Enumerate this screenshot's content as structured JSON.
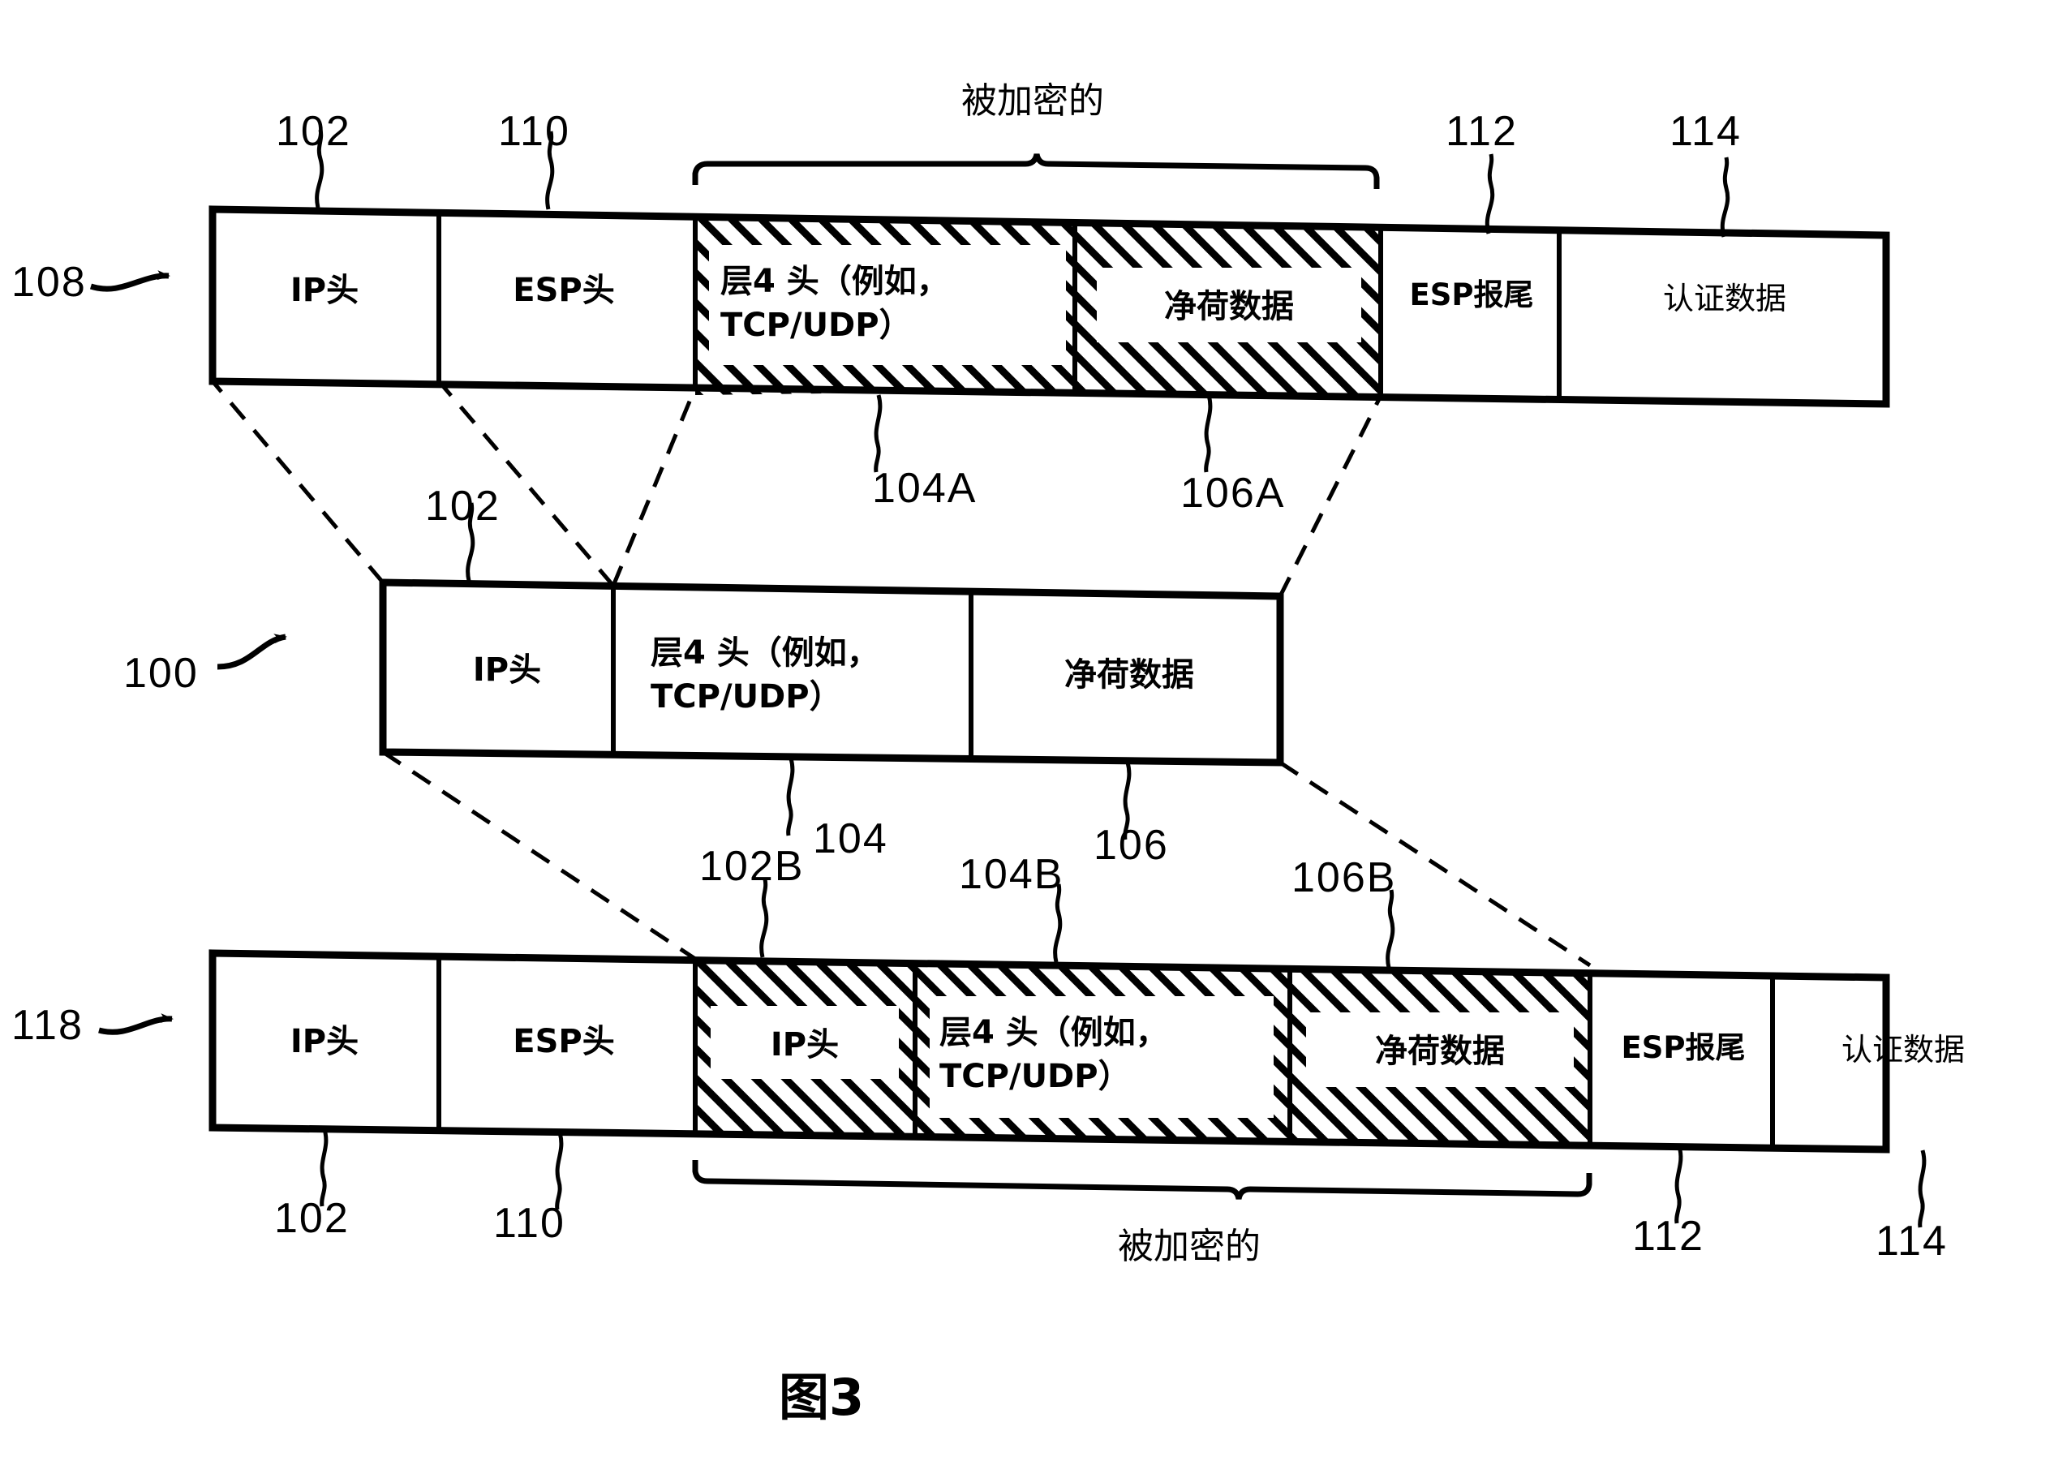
{
  "figure": {
    "caption": "图3",
    "encrypted_label": "被加密的"
  },
  "rows": [
    {
      "id": "transport-mode-packet",
      "ref": "108",
      "cells": [
        {
          "label": "IP头",
          "ref": "102",
          "hatched": false
        },
        {
          "label": "ESP头",
          "ref": "110",
          "hatched": false
        },
        {
          "label_line1": "层4 头（例如，",
          "label_line2": "TCP/UDP）",
          "ref": "104A",
          "hatched": true
        },
        {
          "label": "净荷数据",
          "ref": "106A",
          "hatched": true
        },
        {
          "label": "ESP报尾",
          "ref": "112",
          "hatched": false
        },
        {
          "label": "认证数据",
          "ref": "114",
          "hatched": false
        }
      ]
    },
    {
      "id": "original-packet",
      "ref": "100",
      "cells": [
        {
          "label": "IP头",
          "ref": "102",
          "hatched": false
        },
        {
          "label_line1": "层4 头（例如，",
          "label_line2": "TCP/UDP）",
          "ref": "104",
          "hatched": false
        },
        {
          "label": "净荷数据",
          "ref": "106",
          "hatched": false
        }
      ]
    },
    {
      "id": "tunnel-mode-packet",
      "ref": "118",
      "cells": [
        {
          "label": "IP头",
          "ref": "102",
          "hatched": false
        },
        {
          "label": "ESP头",
          "ref": "110",
          "hatched": false
        },
        {
          "label": "IP头",
          "ref": "102B",
          "hatched": true
        },
        {
          "label_line1": "层4 头（例如，",
          "label_line2": "TCP/UDP）",
          "ref": "104B",
          "hatched": true
        },
        {
          "label": "净荷数据",
          "ref": "106B",
          "hatched": true
        },
        {
          "label": "ESP报尾",
          "ref": "112",
          "hatched": false
        },
        {
          "label": "认证数据",
          "ref": "114",
          "hatched": false
        }
      ]
    }
  ],
  "colors": {
    "ink": "#000000",
    "paper": "#ffffff"
  }
}
